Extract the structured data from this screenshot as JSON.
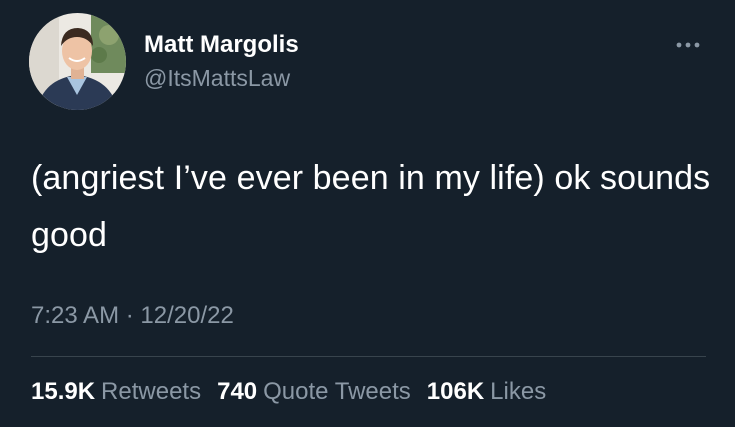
{
  "author": {
    "display_name": "Matt Margolis",
    "handle": "@ItsMattsLaw"
  },
  "tweet": {
    "text": "(angriest I’ve ever been in my life) ok sounds good",
    "time": "7:23 AM",
    "separator": "·",
    "date": "12/20/22"
  },
  "stats": {
    "retweets_count": "15.9K",
    "retweets_label": "Retweets",
    "quotes_count": "740",
    "quotes_label": "Quote Tweets",
    "likes_count": "106K",
    "likes_label": "Likes"
  },
  "colors": {
    "background": "#15202b",
    "primary_text": "#ffffff",
    "secondary_text": "#8b98a5",
    "divider": "#38444d"
  },
  "icons": {
    "more": "more-horizontal-icon"
  }
}
